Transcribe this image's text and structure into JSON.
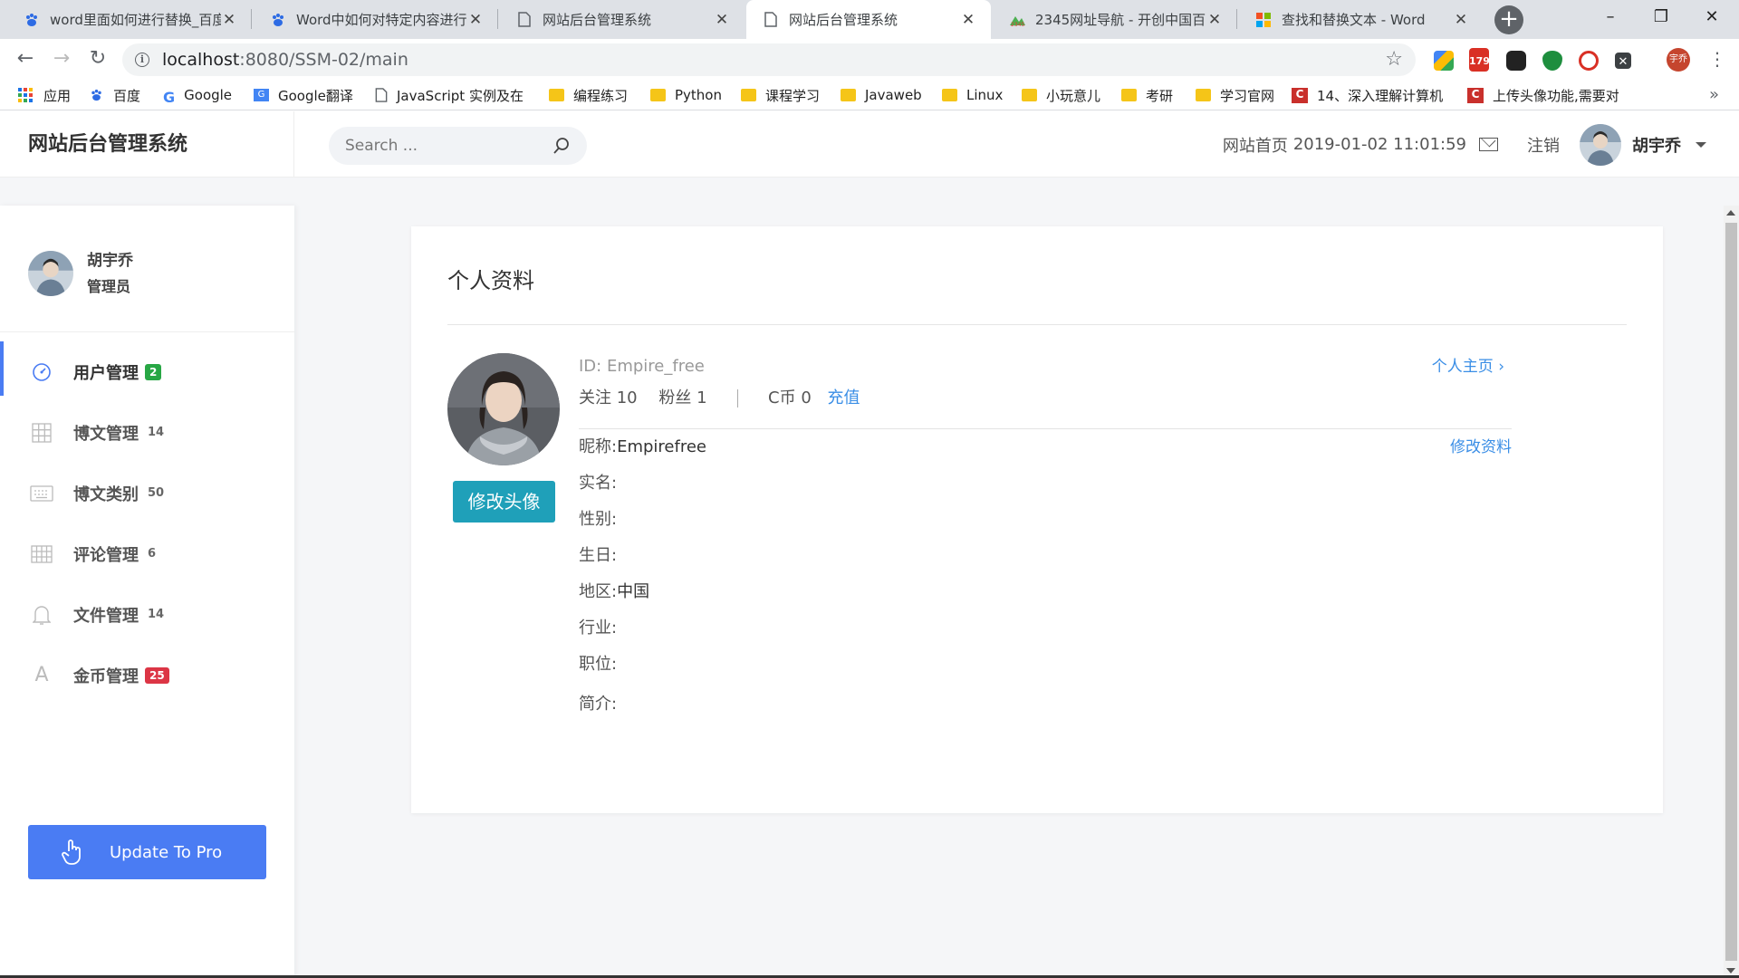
{
  "browser": {
    "tabs": [
      {
        "title": "word里面如何进行替换_百度",
        "icon": "baidu-paw-icon",
        "active": false
      },
      {
        "title": "Word中如何对特定内容进行",
        "icon": "baidu-paw-icon",
        "active": false
      },
      {
        "title": "网站后台管理系统",
        "icon": "page-icon",
        "active": false
      },
      {
        "title": "网站后台管理系统",
        "icon": "page-icon",
        "active": true
      },
      {
        "title": "2345网址导航 - 开创中国百",
        "icon": "site-2345-icon",
        "active": false
      },
      {
        "title": "查找和替换文本 - Word",
        "icon": "microsoft-icon",
        "active": false
      }
    ],
    "address": {
      "host": "localhost",
      "path": ":8080/SSM-02/main"
    },
    "bookmarks": [
      {
        "label": "应用",
        "icon": "apps-icon"
      },
      {
        "label": "百度",
        "icon": "baidu-paw-icon"
      },
      {
        "label": "Google",
        "icon": "google-icon"
      },
      {
        "label": "Google翻译",
        "icon": "translate-icon"
      },
      {
        "label": "JavaScript 实例及在",
        "icon": "page-icon"
      },
      {
        "label": "编程练习",
        "icon": "folder-icon"
      },
      {
        "label": "Python",
        "icon": "folder-icon"
      },
      {
        "label": "课程学习",
        "icon": "folder-icon"
      },
      {
        "label": "Javaweb",
        "icon": "folder-icon"
      },
      {
        "label": "Linux",
        "icon": "folder-icon"
      },
      {
        "label": "小玩意儿",
        "icon": "folder-icon"
      },
      {
        "label": "考研",
        "icon": "folder-icon"
      },
      {
        "label": "学习官网",
        "icon": "folder-icon"
      },
      {
        "label": "14、深入理解计算机",
        "icon": "csdn-icon"
      },
      {
        "label": "上传头像功能,需要对",
        "icon": "csdn-icon"
      }
    ],
    "extension_badge": "179",
    "profile_badge": "宇乔"
  },
  "header": {
    "brand": "网站后台管理系统",
    "search_placeholder": "Search ...",
    "home_link": "网站首页",
    "datetime": "2019-01-02 11:01:59",
    "logout": "注销",
    "username": "胡宇乔"
  },
  "sidebar": {
    "user": {
      "name": "胡宇乔",
      "role": "管理员"
    },
    "items": [
      {
        "label": "用户管理",
        "icon": "dashboard-icon",
        "badge": "2",
        "badge_color": "#28a745",
        "active": true
      },
      {
        "label": "博文管理",
        "icon": "grid-icon",
        "count": "14"
      },
      {
        "label": "博文类别",
        "icon": "keyboard-icon",
        "count": "50"
      },
      {
        "label": "评论管理",
        "icon": "table-icon",
        "count": "6"
      },
      {
        "label": "文件管理",
        "icon": "bell-icon",
        "count": "14"
      },
      {
        "label": "金币管理",
        "icon": "font-icon",
        "badge": "25",
        "badge_color": "#dc3545"
      }
    ],
    "upgrade_button": "Update To Pro"
  },
  "profile": {
    "title": "个人资料",
    "id_label": "ID:",
    "id_value": "Empire_free",
    "home_link": "个人主页",
    "follow_label": "关注",
    "follow_count": "10",
    "fans_label": "粉丝",
    "fans_count": "1",
    "coin_label": "C币",
    "coin_count": "0",
    "recharge": "充值",
    "change_avatar": "修改头像",
    "edit_profile": "修改资料",
    "fields": [
      {
        "label": "昵称:",
        "value": "Empirefree"
      },
      {
        "label": "实名:",
        "value": ""
      },
      {
        "label": "性别:",
        "value": ""
      },
      {
        "label": "生日:",
        "value": ""
      },
      {
        "label": "地区:",
        "value": "中国"
      },
      {
        "label": "行业:",
        "value": ""
      },
      {
        "label": "职位:",
        "value": ""
      },
      {
        "label": "简介:",
        "value": ""
      }
    ]
  },
  "colors": {
    "accent": "#4a7cf3",
    "link": "#3a8ee6",
    "teal_button": "#1fa0b9"
  }
}
